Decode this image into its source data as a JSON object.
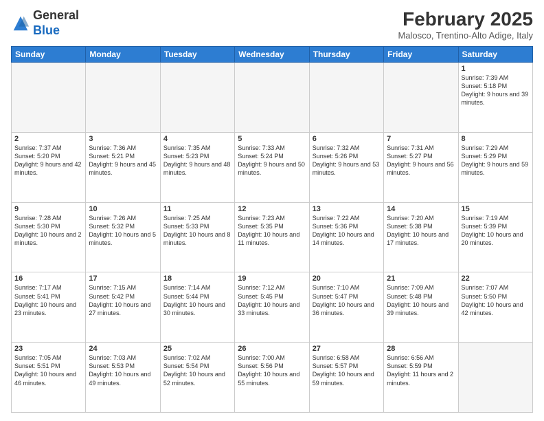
{
  "header": {
    "logo_general": "General",
    "logo_blue": "Blue",
    "month_year": "February 2025",
    "location": "Malosco, Trentino-Alto Adige, Italy"
  },
  "weekdays": [
    "Sunday",
    "Monday",
    "Tuesday",
    "Wednesday",
    "Thursday",
    "Friday",
    "Saturday"
  ],
  "weeks": [
    [
      {
        "day": "",
        "info": ""
      },
      {
        "day": "",
        "info": ""
      },
      {
        "day": "",
        "info": ""
      },
      {
        "day": "",
        "info": ""
      },
      {
        "day": "",
        "info": ""
      },
      {
        "day": "",
        "info": ""
      },
      {
        "day": "1",
        "info": "Sunrise: 7:39 AM\nSunset: 5:18 PM\nDaylight: 9 hours and 39 minutes."
      }
    ],
    [
      {
        "day": "2",
        "info": "Sunrise: 7:37 AM\nSunset: 5:20 PM\nDaylight: 9 hours and 42 minutes."
      },
      {
        "day": "3",
        "info": "Sunrise: 7:36 AM\nSunset: 5:21 PM\nDaylight: 9 hours and 45 minutes."
      },
      {
        "day": "4",
        "info": "Sunrise: 7:35 AM\nSunset: 5:23 PM\nDaylight: 9 hours and 48 minutes."
      },
      {
        "day": "5",
        "info": "Sunrise: 7:33 AM\nSunset: 5:24 PM\nDaylight: 9 hours and 50 minutes."
      },
      {
        "day": "6",
        "info": "Sunrise: 7:32 AM\nSunset: 5:26 PM\nDaylight: 9 hours and 53 minutes."
      },
      {
        "day": "7",
        "info": "Sunrise: 7:31 AM\nSunset: 5:27 PM\nDaylight: 9 hours and 56 minutes."
      },
      {
        "day": "8",
        "info": "Sunrise: 7:29 AM\nSunset: 5:29 PM\nDaylight: 9 hours and 59 minutes."
      }
    ],
    [
      {
        "day": "9",
        "info": "Sunrise: 7:28 AM\nSunset: 5:30 PM\nDaylight: 10 hours and 2 minutes."
      },
      {
        "day": "10",
        "info": "Sunrise: 7:26 AM\nSunset: 5:32 PM\nDaylight: 10 hours and 5 minutes."
      },
      {
        "day": "11",
        "info": "Sunrise: 7:25 AM\nSunset: 5:33 PM\nDaylight: 10 hours and 8 minutes."
      },
      {
        "day": "12",
        "info": "Sunrise: 7:23 AM\nSunset: 5:35 PM\nDaylight: 10 hours and 11 minutes."
      },
      {
        "day": "13",
        "info": "Sunrise: 7:22 AM\nSunset: 5:36 PM\nDaylight: 10 hours and 14 minutes."
      },
      {
        "day": "14",
        "info": "Sunrise: 7:20 AM\nSunset: 5:38 PM\nDaylight: 10 hours and 17 minutes."
      },
      {
        "day": "15",
        "info": "Sunrise: 7:19 AM\nSunset: 5:39 PM\nDaylight: 10 hours and 20 minutes."
      }
    ],
    [
      {
        "day": "16",
        "info": "Sunrise: 7:17 AM\nSunset: 5:41 PM\nDaylight: 10 hours and 23 minutes."
      },
      {
        "day": "17",
        "info": "Sunrise: 7:15 AM\nSunset: 5:42 PM\nDaylight: 10 hours and 27 minutes."
      },
      {
        "day": "18",
        "info": "Sunrise: 7:14 AM\nSunset: 5:44 PM\nDaylight: 10 hours and 30 minutes."
      },
      {
        "day": "19",
        "info": "Sunrise: 7:12 AM\nSunset: 5:45 PM\nDaylight: 10 hours and 33 minutes."
      },
      {
        "day": "20",
        "info": "Sunrise: 7:10 AM\nSunset: 5:47 PM\nDaylight: 10 hours and 36 minutes."
      },
      {
        "day": "21",
        "info": "Sunrise: 7:09 AM\nSunset: 5:48 PM\nDaylight: 10 hours and 39 minutes."
      },
      {
        "day": "22",
        "info": "Sunrise: 7:07 AM\nSunset: 5:50 PM\nDaylight: 10 hours and 42 minutes."
      }
    ],
    [
      {
        "day": "23",
        "info": "Sunrise: 7:05 AM\nSunset: 5:51 PM\nDaylight: 10 hours and 46 minutes."
      },
      {
        "day": "24",
        "info": "Sunrise: 7:03 AM\nSunset: 5:53 PM\nDaylight: 10 hours and 49 minutes."
      },
      {
        "day": "25",
        "info": "Sunrise: 7:02 AM\nSunset: 5:54 PM\nDaylight: 10 hours and 52 minutes."
      },
      {
        "day": "26",
        "info": "Sunrise: 7:00 AM\nSunset: 5:56 PM\nDaylight: 10 hours and 55 minutes."
      },
      {
        "day": "27",
        "info": "Sunrise: 6:58 AM\nSunset: 5:57 PM\nDaylight: 10 hours and 59 minutes."
      },
      {
        "day": "28",
        "info": "Sunrise: 6:56 AM\nSunset: 5:59 PM\nDaylight: 11 hours and 2 minutes."
      },
      {
        "day": "",
        "info": ""
      }
    ]
  ]
}
